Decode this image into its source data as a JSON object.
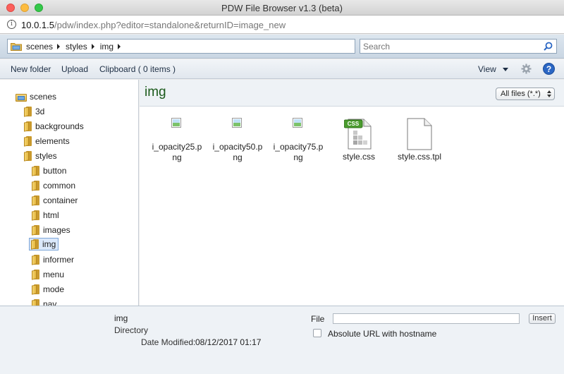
{
  "window": {
    "title": "PDW File Browser v1.3 (beta)"
  },
  "address": {
    "host": "10.0.1.5",
    "path": "/pdw/index.php?editor=standalone&returnID=image_new"
  },
  "breadcrumb": [
    "scenes",
    "styles",
    "img"
  ],
  "search": {
    "placeholder": "Search"
  },
  "toolbar": {
    "new_folder": "New folder",
    "upload": "Upload",
    "clipboard": "Clipboard ( 0 items )",
    "view": "View",
    "help": "?"
  },
  "tree": {
    "root": "scenes",
    "level1": [
      "3d",
      "backgrounds",
      "elements",
      "styles"
    ],
    "level2": [
      "button",
      "common",
      "container",
      "html",
      "images",
      "img",
      "informer",
      "menu",
      "mode",
      "nav"
    ],
    "selected": "img"
  },
  "main": {
    "folder_title": "img",
    "filter": "All files (*.*)",
    "files": [
      {
        "name": "i_opacity25.png",
        "icon": "broken-image-icon"
      },
      {
        "name": "i_opacity50.png",
        "icon": "broken-image-icon"
      },
      {
        "name": "i_opacity75.png",
        "icon": "broken-image-icon"
      },
      {
        "name": "style.css",
        "icon": "css-file-icon",
        "badge": "CSS"
      },
      {
        "name": "style.css.tpl",
        "icon": "blank-file-icon"
      }
    ]
  },
  "details": {
    "name": "img",
    "type": "Directory",
    "modified_label": "Date Modified:",
    "modified_value": "08/12/2017 01:17",
    "file_label": "File",
    "file_value": "",
    "insert": "Insert",
    "absolute_url": "Absolute URL with hostname"
  },
  "colors": {
    "folder_title": "#1b5a1b",
    "selection": "#dbe9fb",
    "help": "#2a66c4"
  }
}
